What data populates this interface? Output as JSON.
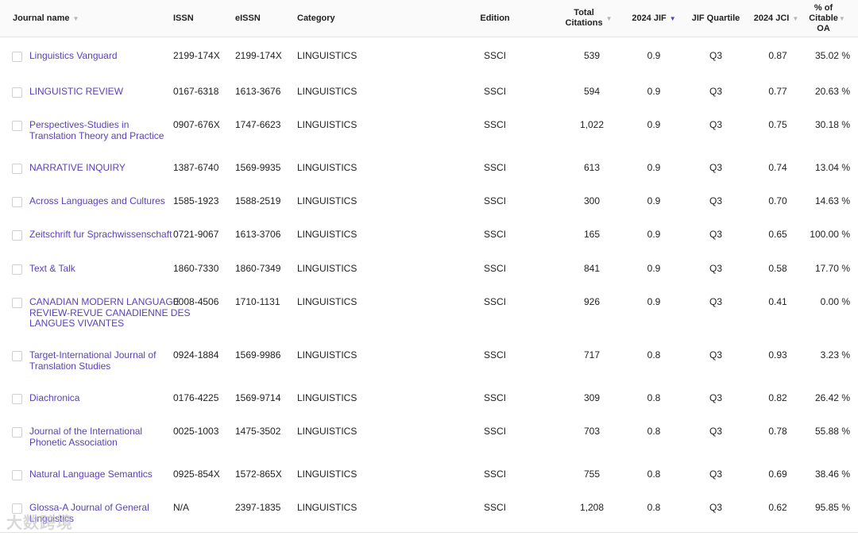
{
  "columns": {
    "journal": "Journal name",
    "issn": "ISSN",
    "eissn": "eISSN",
    "category": "Category",
    "edition": "Edition",
    "citations_1": "Total",
    "citations_2": "Citations",
    "jif": "2024 JIF",
    "quartile": "JIF Quartile",
    "jci": "2024 JCI",
    "oa_1": "% of",
    "oa_2": "Citable",
    "oa_3": "OA"
  },
  "rows": [
    {
      "name": [
        "Linguistics Vanguard"
      ],
      "issn": "2199-174X",
      "eissn": "2199-174X",
      "category": "LINGUISTICS",
      "edition": "SSCI",
      "citations": "539",
      "jif": "0.9",
      "quartile": "Q3",
      "jci": "0.87",
      "oa": "35.02 %"
    },
    {
      "name": [
        "LINGUISTIC REVIEW"
      ],
      "issn": "0167-6318",
      "eissn": "1613-3676",
      "category": "LINGUISTICS",
      "edition": "SSCI",
      "citations": "594",
      "jif": "0.9",
      "quartile": "Q3",
      "jci": "0.77",
      "oa": "20.63 %"
    },
    {
      "name": [
        "Perspectives-Studies in",
        "Translation Theory and Practice"
      ],
      "issn": "0907-676X",
      "eissn": "1747-6623",
      "category": "LINGUISTICS",
      "edition": "SSCI",
      "citations": "1,022",
      "jif": "0.9",
      "quartile": "Q3",
      "jci": "0.75",
      "oa": "30.18 %"
    },
    {
      "name": [
        "NARRATIVE INQUIRY"
      ],
      "issn": "1387-6740",
      "eissn": "1569-9935",
      "category": "LINGUISTICS",
      "edition": "SSCI",
      "citations": "613",
      "jif": "0.9",
      "quartile": "Q3",
      "jci": "0.74",
      "oa": "13.04 %"
    },
    {
      "name": [
        "Across Languages and Cultures"
      ],
      "issn": "1585-1923",
      "eissn": "1588-2519",
      "category": "LINGUISTICS",
      "edition": "SSCI",
      "citations": "300",
      "jif": "0.9",
      "quartile": "Q3",
      "jci": "0.70",
      "oa": "14.63 %"
    },
    {
      "name": [
        "Zeitschrift fur Sprachwissenschaft"
      ],
      "issn": "0721-9067",
      "eissn": "1613-3706",
      "category": "LINGUISTICS",
      "edition": "SSCI",
      "citations": "165",
      "jif": "0.9",
      "quartile": "Q3",
      "jci": "0.65",
      "oa": "100.00 %"
    },
    {
      "name": [
        "Text & Talk"
      ],
      "issn": "1860-7330",
      "eissn": "1860-7349",
      "category": "LINGUISTICS",
      "edition": "SSCI",
      "citations": "841",
      "jif": "0.9",
      "quartile": "Q3",
      "jci": "0.58",
      "oa": "17.70 %"
    },
    {
      "name": [
        "CANADIAN MODERN LANGUAGE",
        "REVIEW-REVUE CANADIENNE DES",
        "LANGUES VIVANTES"
      ],
      "issn": "0008-4506",
      "eissn": "1710-1131",
      "category": "LINGUISTICS",
      "edition": "SSCI",
      "citations": "926",
      "jif": "0.9",
      "quartile": "Q3",
      "jci": "0.41",
      "oa": "0.00 %"
    },
    {
      "name": [
        "Target-International Journal of",
        "Translation Studies"
      ],
      "issn": "0924-1884",
      "eissn": "1569-9986",
      "category": "LINGUISTICS",
      "edition": "SSCI",
      "citations": "717",
      "jif": "0.8",
      "quartile": "Q3",
      "jci": "0.93",
      "oa": "3.23 %"
    },
    {
      "name": [
        "Diachronica"
      ],
      "issn": "0176-4225",
      "eissn": "1569-9714",
      "category": "LINGUISTICS",
      "edition": "SSCI",
      "citations": "309",
      "jif": "0.8",
      "quartile": "Q3",
      "jci": "0.82",
      "oa": "26.42 %"
    },
    {
      "name": [
        "Journal of the International",
        "Phonetic Association"
      ],
      "issn": "0025-1003",
      "eissn": "1475-3502",
      "category": "LINGUISTICS",
      "edition": "SSCI",
      "citations": "703",
      "jif": "0.8",
      "quartile": "Q3",
      "jci": "0.78",
      "oa": "55.88 %"
    },
    {
      "name": [
        "Natural Language Semantics"
      ],
      "issn": "0925-854X",
      "eissn": "1572-865X",
      "category": "LINGUISTICS",
      "edition": "SSCI",
      "citations": "755",
      "jif": "0.8",
      "quartile": "Q3",
      "jci": "0.69",
      "oa": "38.46 %"
    },
    {
      "name": [
        "Glossa-A Journal of General",
        "Linguistics"
      ],
      "issn": "N/A",
      "eissn": "2397-1835",
      "category": "LINGUISTICS",
      "edition": "SSCI",
      "citations": "1,208",
      "jif": "0.8",
      "quartile": "Q3",
      "jci": "0.62",
      "oa": "95.85 %"
    }
  ],
  "watermark": "大数跨境",
  "colors": {
    "link": "#5b3fb8",
    "border": "#e4e4e4",
    "header_bg": "#fafafa",
    "sort_active": "#5b3fb8"
  },
  "icons": {
    "sort": "triangle-down-icon",
    "checkbox": "checkbox-icon"
  }
}
